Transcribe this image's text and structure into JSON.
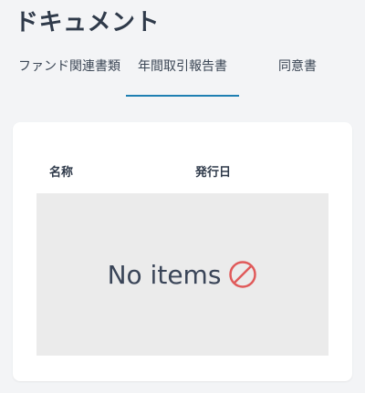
{
  "page": {
    "title": "ドキュメント"
  },
  "tabs": [
    {
      "label": "ファンド関連書類"
    },
    {
      "label": "年間取引報告書"
    },
    {
      "label": "同意書"
    }
  ],
  "table": {
    "columns": [
      "名称",
      "発行日"
    ],
    "empty_text": "No items"
  },
  "colors": {
    "accent": "#1e7fb2",
    "empty_icon": "#e05a5a"
  },
  "icons": {
    "empty": "no-entry-icon"
  }
}
